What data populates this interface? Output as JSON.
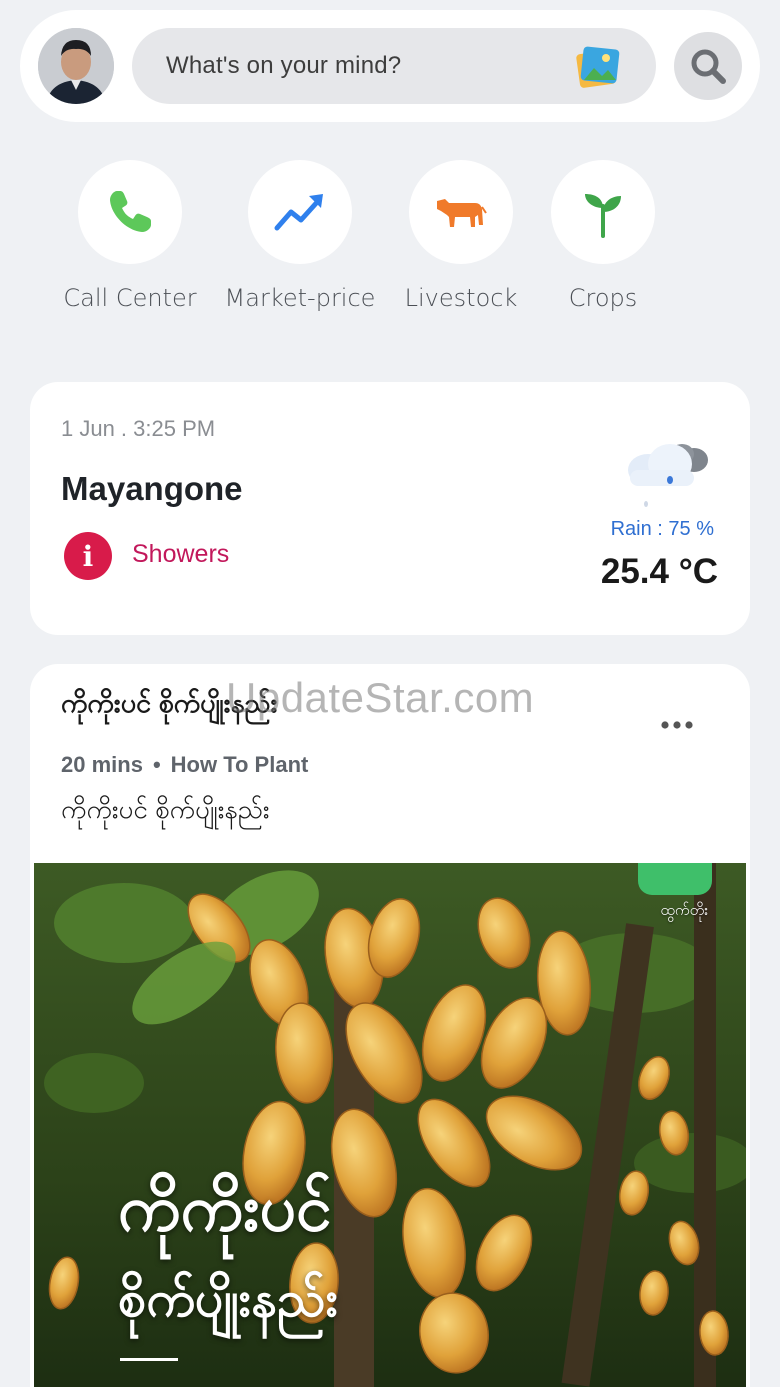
{
  "composer": {
    "placeholder": "What's on your mind?",
    "avatar_icon": "user-avatar",
    "photo_icon": "image-icon",
    "search_icon": "search-icon"
  },
  "quick_actions": [
    {
      "label": "Call Center",
      "icon": "phone-icon",
      "color": "#5dc85a"
    },
    {
      "label": "Market-price",
      "icon": "trend-up-icon",
      "color": "#2f80ed"
    },
    {
      "label": "Livestock",
      "icon": "cow-icon",
      "color": "#f07a2a"
    },
    {
      "label": "Crops",
      "icon": "sprout-icon",
      "color": "#3fa54a"
    }
  ],
  "weather": {
    "datetime": "1 Jun . 3:25 PM",
    "location": "Mayangone",
    "condition": "Showers",
    "rain": "Rain : 75 %",
    "temperature": "25.4 °C",
    "icon": "cloud-rain-icon"
  },
  "post": {
    "title": "ကိုကိုးပင် စိုက်ပျိုးနည်း",
    "watermark": "UpdateStar.com",
    "duration": "20 mins",
    "category": "How To Plant",
    "subtitle": "ကိုကိုးပင် စိုက်ပျိုးနည်း",
    "image_caption_line1": "ကိုကိုးပင်",
    "image_caption_line2": "စိုက်ပျိုးနည်း",
    "logo_text": "ထွက်တိုး"
  }
}
